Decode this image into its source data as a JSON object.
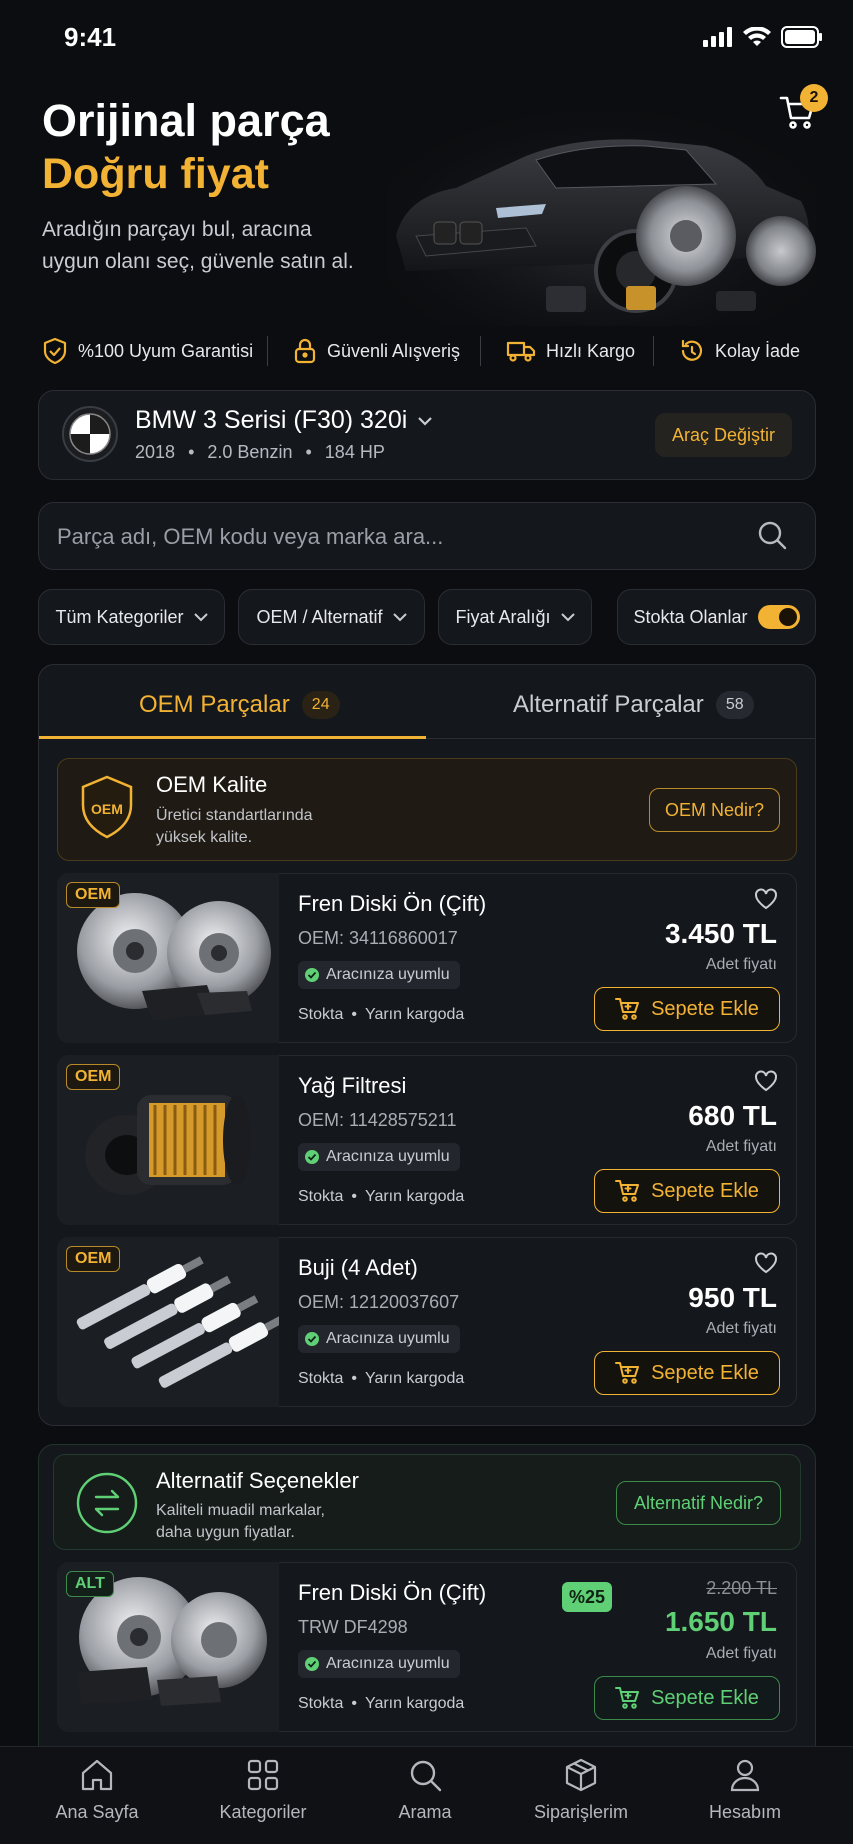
{
  "status": {
    "time": "9:41"
  },
  "hero": {
    "title_line1": "Orijinal parça",
    "title_line2": "Doğru fiyat",
    "subtitle": "Aradığın parçayı bul, aracına uygun olanı seç, güvenle satın al.",
    "cart_count": "2"
  },
  "features": [
    {
      "label": "%100 Uyum Garantisi",
      "icon": "shield-check-icon"
    },
    {
      "label": "Güvenli Alışveriş",
      "icon": "lock-icon"
    },
    {
      "label": "Hızlı Kargo",
      "icon": "truck-icon"
    },
    {
      "label": "Kolay İade",
      "icon": "return-icon"
    }
  ],
  "vehicle": {
    "name": "BMW 3 Serisi (F30) 320i",
    "year": "2018",
    "engine": "2.0 Benzin",
    "power": "184 HP",
    "change_label": "Araç Değiştir"
  },
  "search": {
    "placeholder": "Parça adı, OEM kodu veya marka ara..."
  },
  "filters": {
    "category": "Tüm Kategoriler",
    "type": "OEM / Alternatif",
    "price": "Fiyat Aralığı",
    "in_stock": "Stokta Olanlar",
    "in_stock_on": true
  },
  "tabs": [
    {
      "label": "OEM Parçalar",
      "count": "24",
      "active": true
    },
    {
      "label": "Alternatif Parçalar",
      "count": "58",
      "active": false
    }
  ],
  "oem_banner": {
    "badge": "OEM",
    "title": "OEM Kalite",
    "desc": "Üretici standartlarında yüksek kalite.",
    "button": "OEM Nedir?"
  },
  "oem_products": [
    {
      "badge": "OEM",
      "name": "Fren Diski Ön (Çift)",
      "code": "OEM: 34116860017",
      "fit": "Aracınıza uyumlu",
      "stock": "Stokta",
      "delivery": "Yarın kargoda",
      "price": "3.450 TL",
      "unit": "Adet fiyatı",
      "button": "Sepete Ekle"
    },
    {
      "badge": "OEM",
      "name": "Yağ Filtresi",
      "code": "OEM: 11428575211",
      "fit": "Aracınıza uyumlu",
      "stock": "Stokta",
      "delivery": "Yarın kargoda",
      "price": "680 TL",
      "unit": "Adet fiyatı",
      "button": "Sepete Ekle"
    },
    {
      "badge": "OEM",
      "name": "Buji (4 Adet)",
      "code": "OEM: 12120037607",
      "fit": "Aracınıza uyumlu",
      "stock": "Stokta",
      "delivery": "Yarın kargoda",
      "price": "950 TL",
      "unit": "Adet fiyatı",
      "button": "Sepete Ekle"
    }
  ],
  "alt_banner": {
    "title": "Alternatif Seçenekler",
    "desc": "Kaliteli muadil markalar, daha uygun fiyatlar.",
    "button": "Alternatif Nedir?"
  },
  "alt_products": [
    {
      "badge": "ALT",
      "name": "Fren Diski Ön (Çift)",
      "code": "TRW DF4298",
      "fit": "Aracınıza uyumlu",
      "stock": "Stokta",
      "delivery": "Yarın kargoda",
      "discount": "%25",
      "old_price": "2.200 TL",
      "price": "1.650 TL",
      "unit": "Adet fiyatı",
      "button": "Sepete Ekle"
    }
  ],
  "nav": [
    {
      "label": "Ana Sayfa",
      "icon": "home-icon"
    },
    {
      "label": "Kategoriler",
      "icon": "grid-icon"
    },
    {
      "label": "Arama",
      "icon": "search-icon"
    },
    {
      "label": "Siparişlerim",
      "icon": "box-icon"
    },
    {
      "label": "Hesabım",
      "icon": "user-icon"
    }
  ],
  "colors": {
    "accent": "#f2b233",
    "alt": "#5fd075",
    "bg": "#0b0d10",
    "card": "#14171c"
  }
}
